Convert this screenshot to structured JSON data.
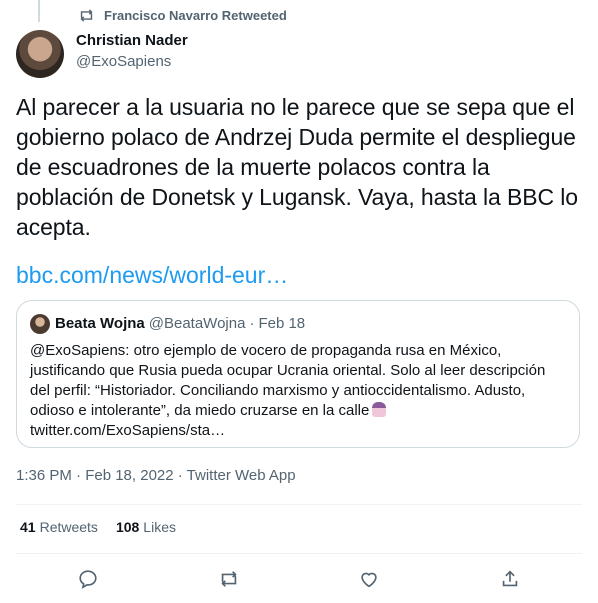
{
  "retweet_header": {
    "label": "Francisco Navarro Retweeted",
    "icon": "retweet-icon"
  },
  "author": {
    "name": "Christian Nader",
    "handle": "@ExoSapiens"
  },
  "tweet": {
    "text": "Al parecer a la usuaria no le parece que se sepa que el gobierno polaco de Andrzej Duda permite el despliegue de escuadrones de la muerte polacos contra la población de Donetsk y Lugansk. Vaya, hasta la BBC lo acepta.",
    "link": "bbc.com/news/world-eur…"
  },
  "quoted": {
    "name": "Beata Wojna",
    "handle": "@BeataWojna",
    "separator": "·",
    "date": "Feb 18",
    "text": "@ExoSapiens: otro ejemplo de vocero de propaganda rusa en México, justificando que Rusia pueda ocupar Ucrania oriental. Solo al leer descripción del perfil: “Historiador. Conciliando marxismo y antioccidentalismo. Adusto, odioso e intolerante”, da miedo cruzarse en la calle",
    "link": "twitter.com/ExoSapiens/sta…"
  },
  "meta": {
    "timestamp": "1:36 PM · Feb 18, 2022 · Twitter Web App"
  },
  "stats": {
    "retweets_count": "41",
    "retweets_label": "Retweets",
    "likes_count": "108",
    "likes_label": "Likes"
  },
  "actions": [
    "reply-icon",
    "retweet-icon",
    "like-icon",
    "share-icon"
  ],
  "colors": {
    "accent": "#1d9bf0",
    "secondary_text": "#536471",
    "border": "#cfd9de"
  }
}
